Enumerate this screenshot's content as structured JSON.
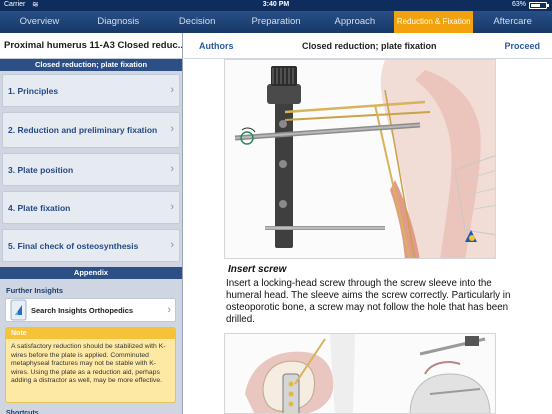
{
  "status_bar": {
    "carrier": "Carrier",
    "time": "3:40 PM",
    "battery": "63%",
    "battery_level": 0.63
  },
  "tabs": [
    {
      "label": "Overview",
      "active": false
    },
    {
      "label": "Diagnosis",
      "active": false
    },
    {
      "label": "Decision",
      "active": false
    },
    {
      "label": "Preparation",
      "active": false
    },
    {
      "label": "Approach",
      "active": false
    },
    {
      "label": "Reduction & Fixation",
      "active": true
    },
    {
      "label": "Aftercare",
      "active": false
    }
  ],
  "left_panel": {
    "title": "Proximal humerus 11-A3 Closed reduc...",
    "section": "Closed reduction; plate fixation",
    "items": [
      {
        "label": "1. Principles"
      },
      {
        "label": "2. Reduction and preliminary fixation"
      },
      {
        "label": "3. Plate position"
      },
      {
        "label": "4. Plate fixation"
      },
      {
        "label": "5. Final check of osteosynthesis"
      }
    ],
    "appendix": "Appendix",
    "further_insights": "Further Insights",
    "insights_button": "Search Insights Orthopedics",
    "note_title": "Note",
    "note_text": "A satisfactory reduction should be stabilized with K-wires before the plate is applied. Comminuted metaphyseal fractures may not be stable with K-wires. Using the plate as a reduction aid, perhaps adding a distractor as well, may be more effective.",
    "shortcuts": "Shortcuts"
  },
  "right_panel": {
    "authors": "Authors",
    "title": "Closed reduction; plate fixation",
    "proceed": "Proceed",
    "caption_title": "Insert screw",
    "caption_text": "Insert a locking-head screw through the screw sleeve into the humeral head. The sleeve aims the screw correctly. Particularly in osteoporotic bone, a screw may not follow the hole that has been drilled."
  },
  "colors": {
    "nav_blue": "#173968",
    "active_tab": "#f2a20c",
    "link_blue": "#2b5aa0",
    "note_bg": "#fde9a4"
  }
}
